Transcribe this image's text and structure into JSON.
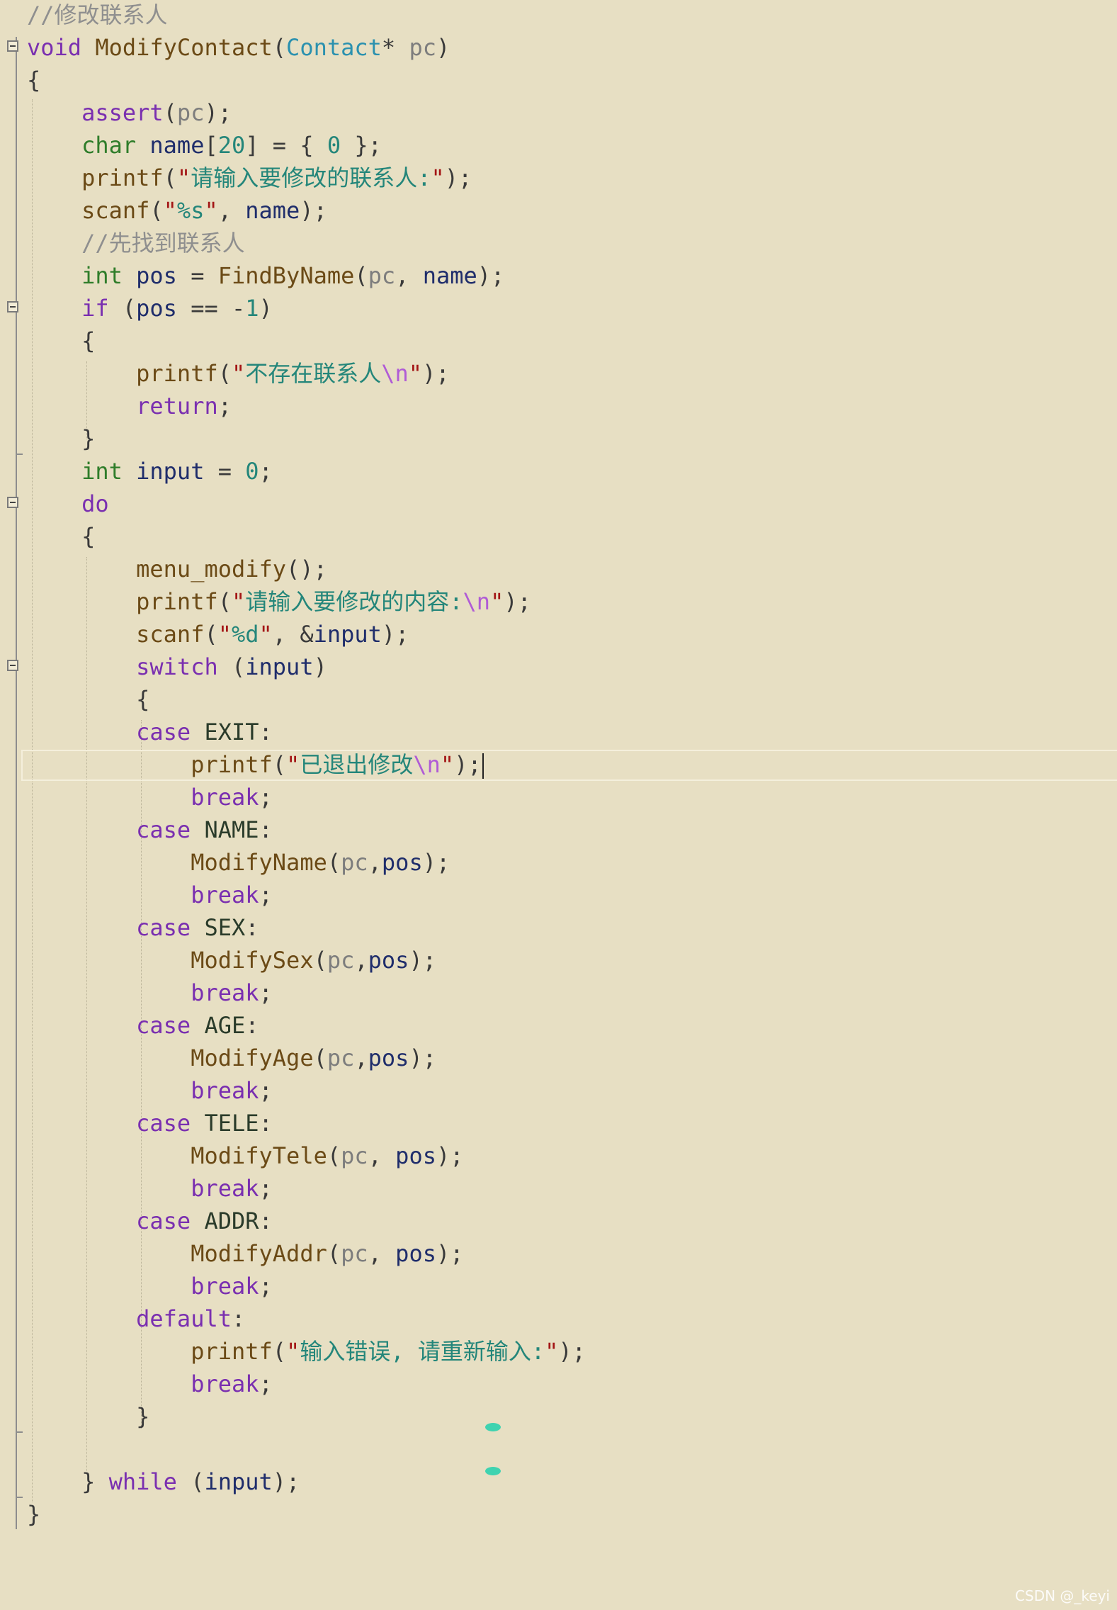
{
  "watermark": "CSDN @_keyi",
  "code": {
    "lines": [
      "//修改联系人",
      "void ModifyContact(Contact* pc)",
      "{",
      "    assert(pc);",
      "    char name[20] = { 0 };",
      "    printf(\"请输入要修改的联系人:\");",
      "    scanf(\"%s\", name);",
      "    //先找到联系人",
      "    int pos = FindByName(pc, name);",
      "    if (pos == -1)",
      "    {",
      "        printf(\"不存在联系人\\n\");",
      "        return;",
      "    }",
      "    int input = 0;",
      "    do",
      "    {",
      "        menu_modify();",
      "        printf(\"请输入要修改的内容:\\n\");",
      "        scanf(\"%d\", &input);",
      "        switch (input)",
      "        {",
      "        case EXIT:",
      "            printf(\"已退出修改\\n\");",
      "            break;",
      "        case NAME:",
      "            ModifyName(pc,pos);",
      "            break;",
      "        case SEX:",
      "            ModifySex(pc,pos);",
      "            break;",
      "        case AGE:",
      "            ModifyAge(pc,pos);",
      "            break;",
      "        case TELE:",
      "            ModifyTele(pc, pos);",
      "            break;",
      "        case ADDR:",
      "            ModifyAddr(pc, pos);",
      "            break;",
      "        default:",
      "            printf(\"输入错误, 请重新输入:\");",
      "            break;",
      "        }",
      "",
      "    } while (input);",
      "}"
    ],
    "current_line": 24,
    "fold_lines": [
      2,
      10,
      16,
      21
    ]
  }
}
